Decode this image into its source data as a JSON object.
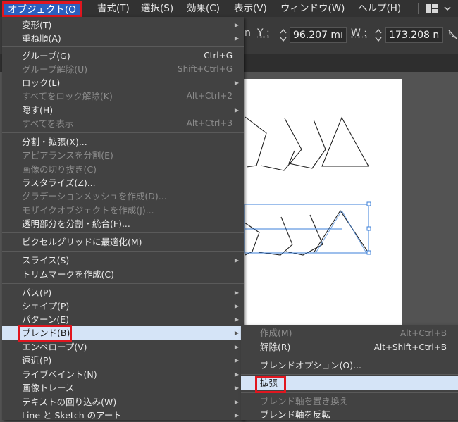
{
  "menubar": {
    "items": [
      "オブジェクト(O",
      "書式(T)",
      "選択(S)",
      "効果(C)",
      "表示(V)",
      "ウィンドウ(W)",
      "ヘルプ(H)"
    ],
    "active": "オブジェクト(O"
  },
  "toolbar": {
    "y_label": "Y :",
    "y_value": "96.207 mı",
    "w_label": "W :",
    "w_value": "173.208 n",
    "x_fragment": "n"
  },
  "object_menu": {
    "items": [
      {
        "label": "変形(T)",
        "shortcut": "",
        "submenu": true,
        "disabled": false
      },
      {
        "label": "重ね順(A)",
        "shortcut": "",
        "submenu": true,
        "disabled": false
      },
      {
        "label": "グループ(G)",
        "shortcut": "Ctrl+G",
        "submenu": false,
        "disabled": false
      },
      {
        "label": "グループ解除(U)",
        "shortcut": "Shift+Ctrl+G",
        "submenu": false,
        "disabled": true
      },
      {
        "label": "ロック(L)",
        "shortcut": "",
        "submenu": true,
        "disabled": false
      },
      {
        "label": "すべてをロック解除(K)",
        "shortcut": "Alt+Ctrl+2",
        "submenu": false,
        "disabled": true
      },
      {
        "label": "隠す(H)",
        "shortcut": "",
        "submenu": true,
        "disabled": false
      },
      {
        "label": "すべてを表示",
        "shortcut": "Alt+Ctrl+3",
        "submenu": false,
        "disabled": true
      },
      {
        "label": "分割・拡張(X)...",
        "shortcut": "",
        "submenu": false,
        "disabled": false
      },
      {
        "label": "アピアランスを分割(E)",
        "shortcut": "",
        "submenu": false,
        "disabled": true
      },
      {
        "label": "画像の切り抜き(C)",
        "shortcut": "",
        "submenu": false,
        "disabled": true
      },
      {
        "label": "ラスタライズ(Z)...",
        "shortcut": "",
        "submenu": false,
        "disabled": false
      },
      {
        "label": "グラデーションメッシュを作成(D)...",
        "shortcut": "",
        "submenu": false,
        "disabled": true
      },
      {
        "label": "モザイクオブジェクトを作成(J)...",
        "shortcut": "",
        "submenu": false,
        "disabled": true
      },
      {
        "label": "透明部分を分割・統合(F)...",
        "shortcut": "",
        "submenu": false,
        "disabled": false
      },
      {
        "label": "ピクセルグリッドに最適化(M)",
        "shortcut": "",
        "submenu": false,
        "disabled": false
      },
      {
        "label": "スライス(S)",
        "shortcut": "",
        "submenu": true,
        "disabled": false
      },
      {
        "label": "トリムマークを作成(C)",
        "shortcut": "",
        "submenu": false,
        "disabled": false
      },
      {
        "label": "パス(P)",
        "shortcut": "",
        "submenu": true,
        "disabled": false
      },
      {
        "label": "シェイプ(P)",
        "shortcut": "",
        "submenu": true,
        "disabled": false
      },
      {
        "label": "パターン(E)",
        "shortcut": "",
        "submenu": true,
        "disabled": false
      },
      {
        "label": "ブレンド(B)",
        "shortcut": "",
        "submenu": true,
        "disabled": false,
        "highlighted": true
      },
      {
        "label": "エンベロープ(V)",
        "shortcut": "",
        "submenu": true,
        "disabled": false
      },
      {
        "label": "遠近(P)",
        "shortcut": "",
        "submenu": true,
        "disabled": false
      },
      {
        "label": "ライブペイント(N)",
        "shortcut": "",
        "submenu": true,
        "disabled": false
      },
      {
        "label": "画像トレース",
        "shortcut": "",
        "submenu": true,
        "disabled": false
      },
      {
        "label": "テキストの回り込み(W)",
        "shortcut": "",
        "submenu": true,
        "disabled": false
      },
      {
        "label": "Line と Sketch のアート",
        "shortcut": "",
        "submenu": true,
        "disabled": false
      }
    ]
  },
  "blend_submenu": {
    "items": [
      {
        "label": "作成(M)",
        "shortcut": "Alt+Ctrl+B",
        "disabled": true
      },
      {
        "label": "解除(R)",
        "shortcut": "Alt+Shift+Ctrl+B",
        "disabled": false
      },
      {
        "label": "ブレンドオプション(O)...",
        "shortcut": "",
        "disabled": false
      },
      {
        "label": "拡張",
        "shortcut": "",
        "disabled": false,
        "highlighted": true
      },
      {
        "label": "ブレンド軸を置き換え",
        "shortcut": "",
        "disabled": true
      },
      {
        "label": "ブレンド軸を反転",
        "shortcut": "",
        "disabled": false
      }
    ]
  },
  "colors": {
    "highlight_box": "#e0161f",
    "menu_bg": "#424242",
    "item_highlight": "#d5e4f7",
    "selection": "#3b7fd8"
  }
}
